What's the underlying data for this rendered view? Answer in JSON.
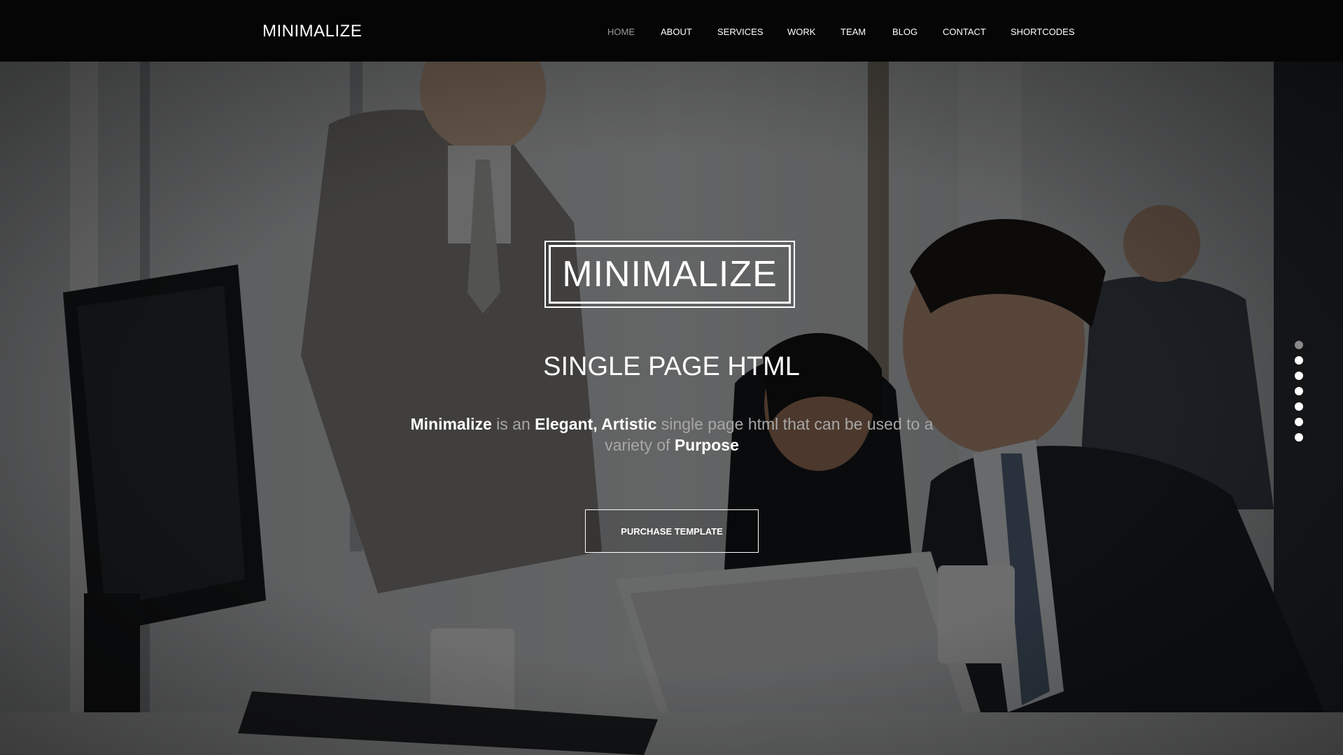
{
  "header": {
    "brand": "MINIMALIZE",
    "nav": [
      {
        "label": "HOME",
        "active": true
      },
      {
        "label": "ABOUT",
        "active": false
      },
      {
        "label": "SERVICES",
        "active": false
      },
      {
        "label": "WORK",
        "active": false
      },
      {
        "label": "TEAM",
        "active": false
      },
      {
        "label": "BLOG",
        "active": false
      },
      {
        "label": "CONTACT",
        "active": false
      },
      {
        "label": "SHORTCODES",
        "active": false
      }
    ]
  },
  "hero": {
    "logo_text": "MINIMALIZE",
    "subtitle": "SINGLE PAGE HTML",
    "tagline": {
      "part1": "Minimalize",
      "part2": " is an ",
      "part3": "Elegant, Artistic",
      "part4": " single page html that can be used to a variety of ",
      "part5": "Purpose"
    },
    "cta_label": "PURCHASE TEMPLATE",
    "background_image": "office-team-photo",
    "slide_dots": 7,
    "active_dot": 0
  },
  "colors": {
    "navbar_bg": "#050505",
    "text_primary": "#ffffff",
    "text_muted": "#a7a7a7",
    "nav_active": "#9a9a9a"
  }
}
